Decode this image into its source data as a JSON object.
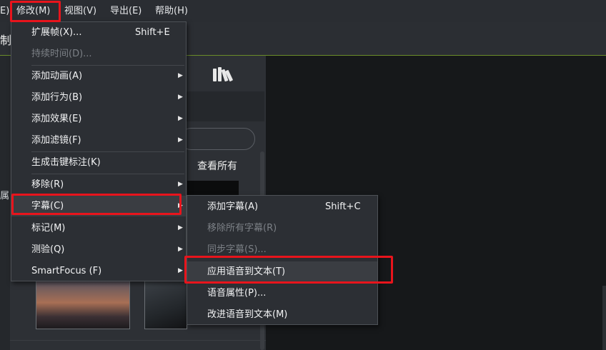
{
  "menubar": {
    "items": [
      {
        "label": "E)"
      },
      {
        "label": "修改(M)"
      },
      {
        "label": "视图(V)"
      },
      {
        "label": "导出(E)"
      },
      {
        "label": "帮助(H)"
      }
    ]
  },
  "title_strip": {
    "text": "制"
  },
  "left_panel": {
    "gutter_text": "属",
    "view_all": "查看所有",
    "library_icon": "library-books-icon"
  },
  "modify_menu": {
    "items": [
      {
        "label": "扩展帧(X)...",
        "shortcut": "Shift+E",
        "disabled": false,
        "submenu": false
      },
      {
        "label": "持续时间(D)...",
        "shortcut": "",
        "disabled": true,
        "submenu": false
      },
      {
        "label": "添加动画(A)",
        "shortcut": "",
        "disabled": false,
        "submenu": true
      },
      {
        "label": "添加行为(B)",
        "shortcut": "",
        "disabled": false,
        "submenu": true
      },
      {
        "label": "添加效果(E)",
        "shortcut": "",
        "disabled": false,
        "submenu": true
      },
      {
        "label": "添加滤镜(F)",
        "shortcut": "",
        "disabled": false,
        "submenu": true
      },
      {
        "label": "生成击键标注(K)",
        "shortcut": "",
        "disabled": false,
        "submenu": false
      },
      {
        "label": "移除(R)",
        "shortcut": "",
        "disabled": false,
        "submenu": true
      },
      {
        "label": "字幕(C)",
        "shortcut": "",
        "disabled": false,
        "submenu": true,
        "active": true
      },
      {
        "label": "标记(M)",
        "shortcut": "",
        "disabled": false,
        "submenu": true
      },
      {
        "label": "测验(Q)",
        "shortcut": "",
        "disabled": false,
        "submenu": true
      },
      {
        "label": "SmartFocus (F)",
        "shortcut": "",
        "disabled": false,
        "submenu": true
      }
    ]
  },
  "caption_submenu": {
    "items": [
      {
        "label": "添加字幕(A)",
        "shortcut": "Shift+C",
        "disabled": false
      },
      {
        "label": "移除所有字幕(R)",
        "shortcut": "",
        "disabled": true
      },
      {
        "label": "同步字幕(S)...",
        "shortcut": "",
        "disabled": true
      },
      {
        "label": "应用语音到文本(T)",
        "shortcut": "",
        "disabled": false,
        "highlighted": true
      },
      {
        "label": "语音属性(P)...",
        "shortcut": "",
        "disabled": false
      },
      {
        "label": "改进语音到文本(M)",
        "shortcut": "",
        "disabled": false
      }
    ]
  },
  "colors": {
    "highlight_box": "#e8141c",
    "accent_line": "#6b8d2a"
  }
}
